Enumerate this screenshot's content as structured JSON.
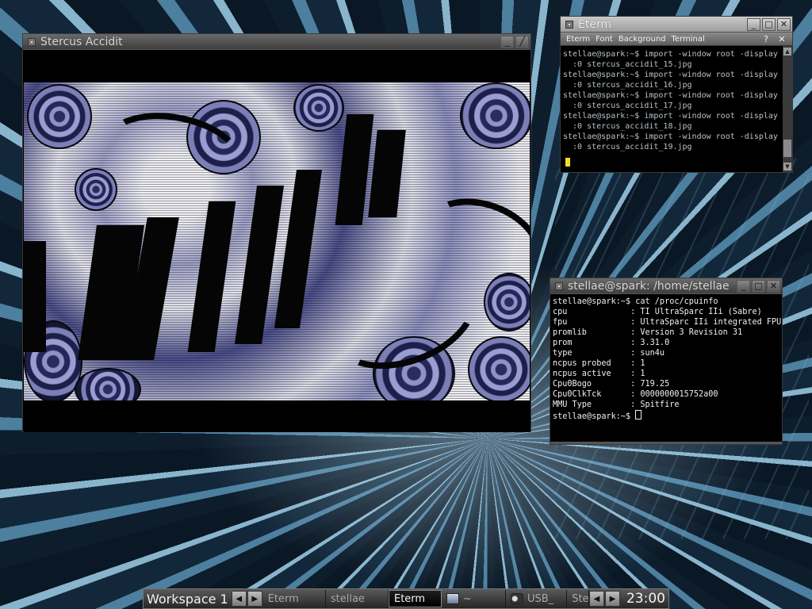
{
  "viewer": {
    "title": "Stercus Accidit"
  },
  "eterm1": {
    "title": "Eterm",
    "menu": [
      "Eterm",
      "Font",
      "Background",
      "Terminal"
    ],
    "help_label": "?",
    "close_label": "✕",
    "lines": [
      "stellae@spark:~$ import -window root -display",
      "  :0 stercus_accidit_15.jpg",
      "stellae@spark:~$ import -window root -display",
      "  :0 stercus_accidit_16.jpg",
      "stellae@spark:~$ import -window root -display",
      "  :0 stercus_accidit_17.jpg",
      "stellae@spark:~$ import -window root -display",
      "  :0 stercus_accidit_18.jpg",
      "stellae@spark:~$ import -window root -display",
      "  :0 stercus_accidit_19.jpg"
    ]
  },
  "eterm2": {
    "title": "stellae@spark: /home/stellae",
    "command": "stellae@spark:~$ cat /proc/cpuinfo",
    "rows": [
      {
        "key": "cpu",
        "value": "TI UltraSparc IIi (Sabre)"
      },
      {
        "key": "fpu",
        "value": "UltraSparc IIi integrated FPU"
      },
      {
        "key": "promlib",
        "value": "Version 3 Revision 31"
      },
      {
        "key": "prom",
        "value": "3.31.0"
      },
      {
        "key": "type",
        "value": "sun4u"
      },
      {
        "key": "ncpus probed",
        "value": "1"
      },
      {
        "key": "ncpus active",
        "value": "1"
      },
      {
        "key": "Cpu0Bogo",
        "value": "719.25"
      },
      {
        "key": "Cpu0ClkTck",
        "value": "0000000015752a00"
      },
      {
        "key": "MMU Type",
        "value": "Spitfire"
      }
    ],
    "prompt": "stellae@spark:~$ "
  },
  "taskbar": {
    "workspace": "Workspace 1",
    "tasks": [
      "Eterm",
      "stellae",
      "Eterm",
      "~",
      "USB_",
      "Ste"
    ],
    "active_task_index": 2,
    "clock": "23:00"
  },
  "icons": {
    "window_menu": "window-menu-icon",
    "minimize": "minimize-icon",
    "maximize": "maximize-icon",
    "close": "close-icon",
    "arrow_left": "arrow-left-icon",
    "arrow_right": "arrow-right-icon"
  }
}
